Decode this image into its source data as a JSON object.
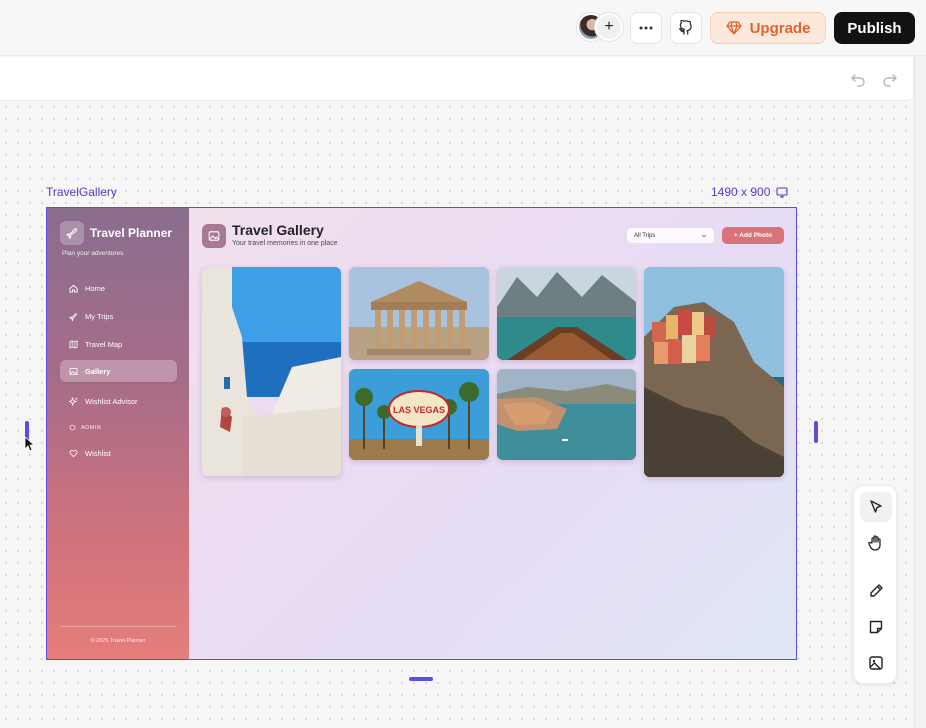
{
  "topbar": {
    "avatar_add_label": "+",
    "upgrade_label": "Upgrade",
    "publish_label": "Publish"
  },
  "canvas": {
    "frame_name": "TravelGallery",
    "frame_size": "1490 x 900"
  },
  "app": {
    "brand_title": "Travel Planner",
    "brand_subtitle": "Plan your adventures",
    "nav": [
      {
        "label": "Home",
        "icon": "home-icon"
      },
      {
        "label": "My Trips",
        "icon": "plane-icon"
      },
      {
        "label": "Travel Map",
        "icon": "map-icon"
      },
      {
        "label": "Gallery",
        "icon": "image-icon",
        "active": true
      },
      {
        "label": "Wishlist Advisor",
        "icon": "sparkles-icon"
      },
      {
        "label": "Wishlist",
        "icon": "heart-icon"
      }
    ],
    "section_label": "ADMIN",
    "footer": "© 2025 Travel Planner",
    "page_title": "Travel Gallery",
    "page_subtitle": "Your travel memories in one place",
    "filter_value": "All Trips",
    "add_photo_label": "+ Add Photo",
    "photos": [
      {
        "name": "santorini-photo",
        "sign_text": ""
      },
      {
        "name": "parthenon-photo",
        "sign_text": ""
      },
      {
        "name": "lake-boat-photo",
        "sign_text": ""
      },
      {
        "name": "cinque-terre-photo",
        "sign_text": ""
      },
      {
        "name": "las-vegas-photo",
        "sign_text": "LAS VEGAS"
      },
      {
        "name": "dubrovnik-photo",
        "sign_text": ""
      }
    ]
  },
  "colors": {
    "accent": "#5b4fe0",
    "upgrade": "#e2622f",
    "publish_bg": "#111214",
    "add_photo": "#d9737a"
  }
}
